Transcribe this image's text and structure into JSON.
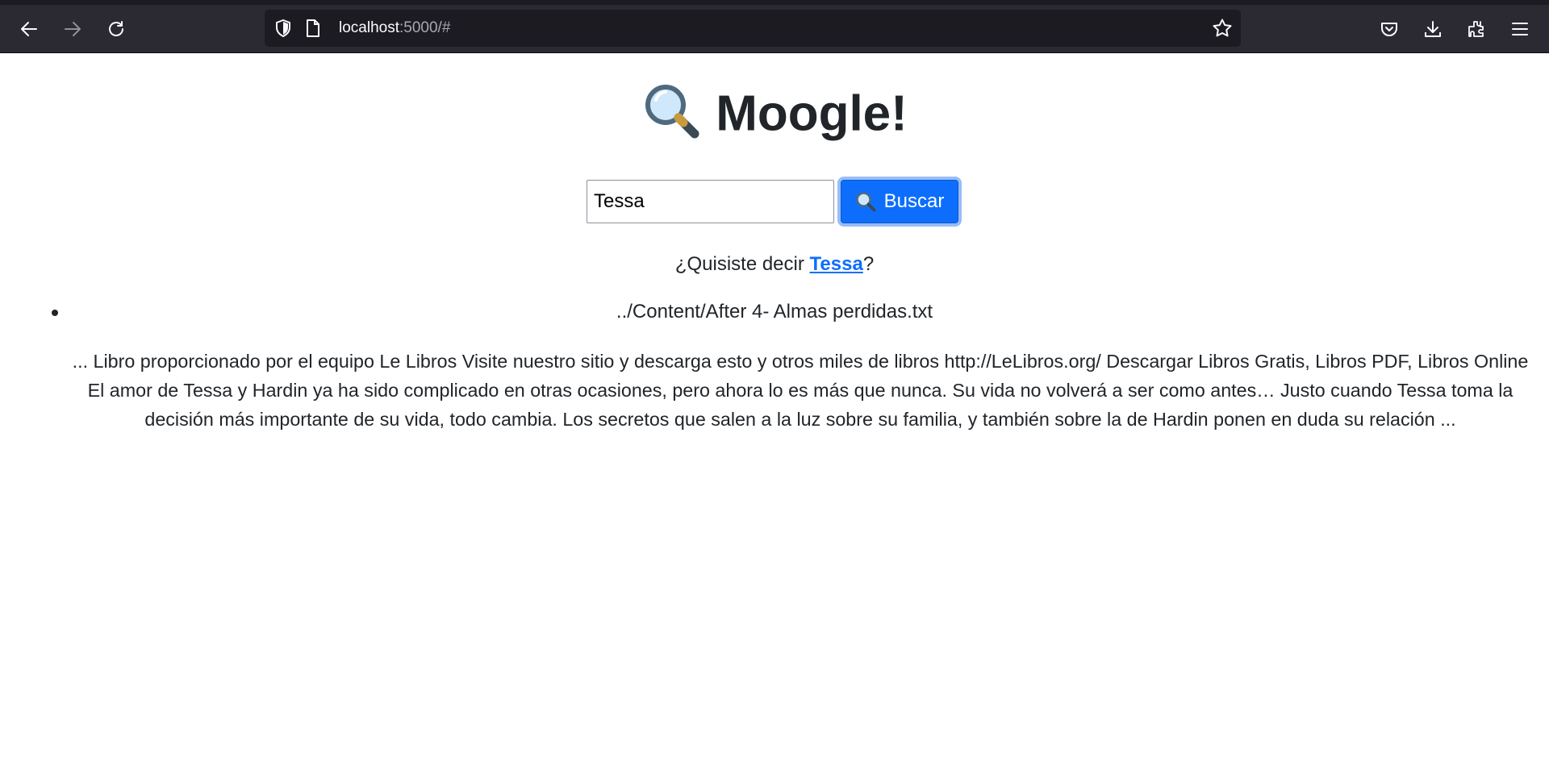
{
  "browser": {
    "url_host": "localhost",
    "url_rest": ":5000/#",
    "icons": [
      "back-arrow-icon",
      "forward-arrow-icon",
      "reload-icon",
      "shield-icon",
      "page-icon",
      "bookmark-star-icon",
      "pocket-icon",
      "download-icon",
      "extensions-icon",
      "menu-icon"
    ]
  },
  "page": {
    "title": "Moogle!",
    "search": {
      "value": "Tessa"
    },
    "search_button": "Buscar",
    "suggestion": {
      "prefix": "¿Quisiste decir ",
      "word": "Tessa",
      "suffix": "?"
    },
    "results": [
      {
        "path": "../Content/After 4- Almas perdidas.txt",
        "snippet": "... Libro proporcionado por el equipo Le Libros Visite nuestro sitio y descarga esto y otros miles de libros http://LeLibros.org/ Descargar Libros Gratis, Libros PDF, Libros Online El amor de Tessa y Hardin ya ha sido complicado en otras ocasiones, pero ahora lo es más que nunca. Su vida no volverá a ser como antes… Justo cuando Tessa toma la decisión más importante de su vida, todo cambia. Los secretos que salen a la luz sobre su familia, y también sobre la de Hardin ponen en duda su relación ..."
      }
    ]
  },
  "colors": {
    "chrome": "#2b2a33",
    "urlbar": "#1c1b22",
    "primary": "#0d6efd",
    "text": "#212529"
  }
}
